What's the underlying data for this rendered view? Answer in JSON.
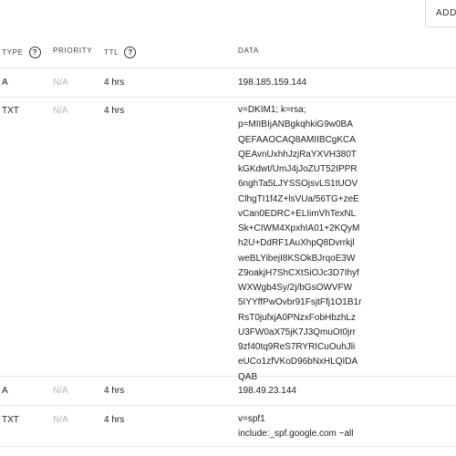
{
  "toolbar": {
    "add_label": "ADD"
  },
  "table": {
    "headers": {
      "type": "TYPE",
      "priority": "PRIORITY",
      "ttl": "TTL",
      "data": "DATA"
    },
    "help_glyph": "?",
    "rows": [
      {
        "type": "A",
        "priority": "N/A",
        "ttl": "4 hrs",
        "data_lines": [
          "198.185.159.144"
        ]
      },
      {
        "type": "TXT",
        "priority": "N/A",
        "ttl": "4 hrs",
        "data_lines": [
          "v=DKIM1; k=rsa;",
          "p=MIIBIjANBgkqhkiG9w0BA",
          "QEFAAOCAQ8AMIIBCgKCA",
          "QEAvnUxhhJzjRaYXVH380T",
          "kGKdwt/UmJ4jJoZUT52IPPR",
          "6nghTa5LJYSSOjsvLS1tUOV",
          "ClhgTI1f4Z+lsVUa/56TG+zeE",
          "vCan0EDRC+ELIimVhTexNL",
          "Sk+CIWM4XpxhIA01+2KQyM",
          "h2U+DdRF1AuXhpQ8Dvrrkjl",
          "weBLYibejI8KSOkBJrqoE3W",
          "Z9oakjH7ShCXtSiOJc3D7Ihyf",
          "WXWgb4Sy/2j/bGsOWVFW",
          "5IYYffPwOvbr91FsjtFfj1O1B1r",
          "RsT0jufxjA0PNzxFobHbzhLz",
          "U3FW0aX75jK7J3QmuOt0jrr",
          "9zf40tq9ReS7RYRICuOuhJli",
          "eUCo1zfVKoD96bNxHLQIDA",
          "QAB"
        ]
      },
      {
        "type": "A",
        "priority": "N/A",
        "ttl": "4 hrs",
        "data_lines": [
          "198.49.23.144"
        ]
      },
      {
        "type": "TXT",
        "priority": "N/A",
        "ttl": "4 hrs",
        "data_lines": [
          "v=spf1",
          "include:_spf.google.com ~all"
        ]
      }
    ]
  },
  "colors": {
    "text": "#222222",
    "muted": "#b5b5b5",
    "border": "#e5e5e5"
  }
}
